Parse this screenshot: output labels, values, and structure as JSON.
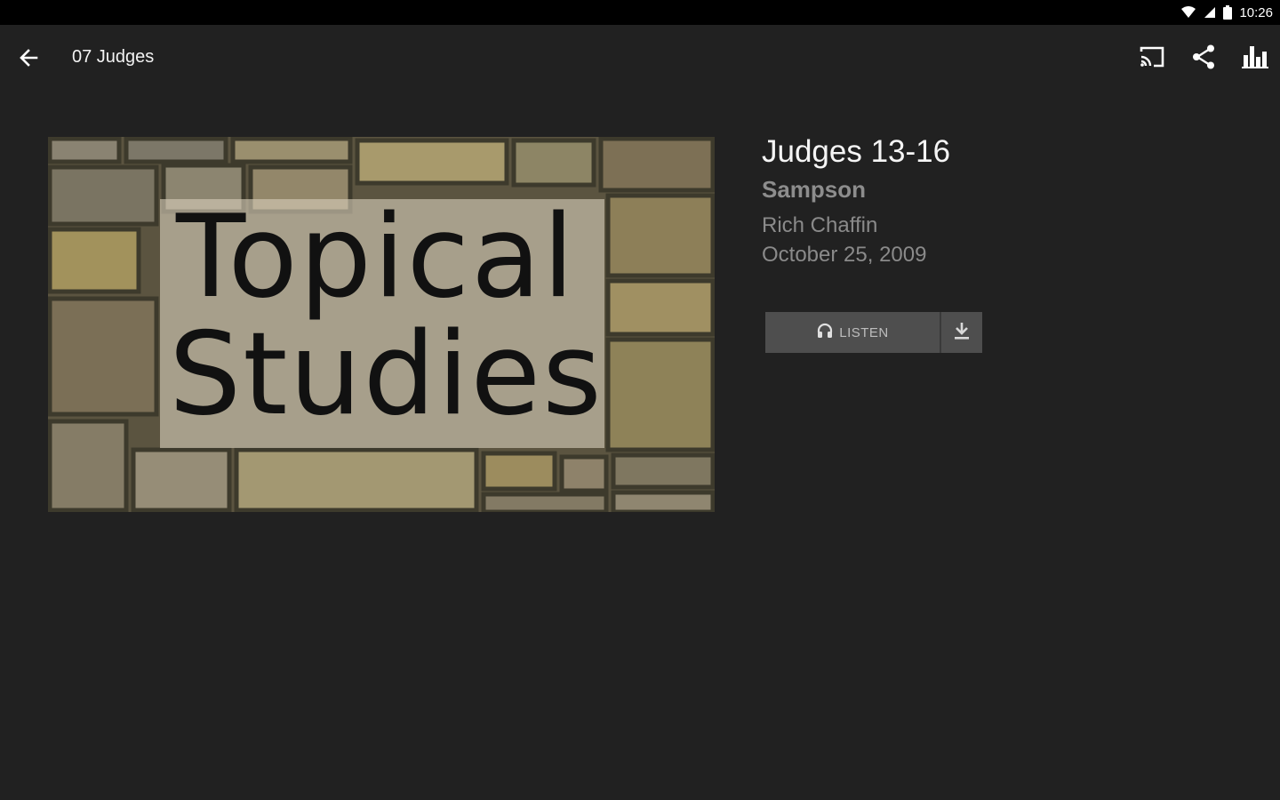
{
  "status_bar": {
    "time": "10:26"
  },
  "app_bar": {
    "title": "07 Judges",
    "actions": [
      "cast-icon",
      "share-icon",
      "bar-chart-icon"
    ]
  },
  "artwork": {
    "line1": "Topical",
    "line2": "Studies"
  },
  "sermon": {
    "title": "Judges 13-16",
    "subtitle": "Sampson",
    "speaker": "Rich Chaffin",
    "date": "October 25, 2009"
  },
  "buttons": {
    "listen_label": "LISTEN",
    "download_icon": "download-icon"
  },
  "colors": {
    "background": "#212121",
    "status_bar": "#000000",
    "button": "#4e4e4e"
  }
}
